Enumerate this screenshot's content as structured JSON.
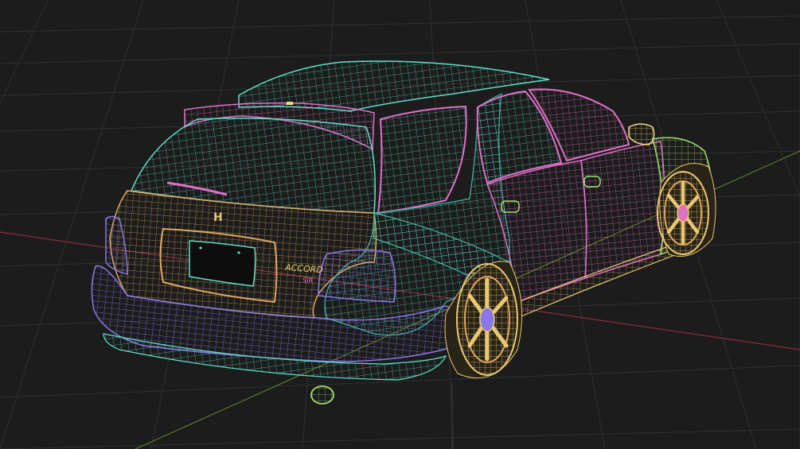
{
  "scene": {
    "subject": "wireframe-car",
    "view": "rear-three-quarter",
    "background_color": "#1c1c1c",
    "grid_color": "#2e2e2e",
    "axis_x_color": "#8a2f3f",
    "axis_y_color": "#5a7a2a",
    "axis_z_color": "#3a3a3a"
  },
  "colors": {
    "cyan": "#5fe0c8",
    "teal": "#3fb8a8",
    "pink": "#e070c8",
    "magenta": "#c050b0",
    "purple": "#8a78e8",
    "violet": "#6a5ad0",
    "orange": "#e0a860",
    "gold": "#e8c870",
    "yellow": "#e8e080",
    "green": "#a0e070",
    "blue": "#6aa0e8"
  },
  "car_badges": {
    "emblem": "H",
    "model_text": "ACCORD",
    "trim_text": "SiR"
  }
}
